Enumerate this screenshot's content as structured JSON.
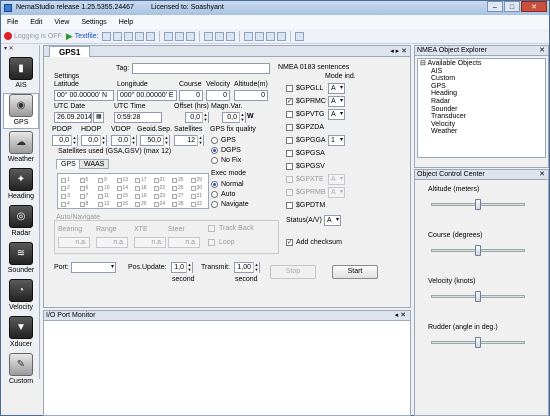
{
  "app": {
    "title": "NemaStudio release 1.25.5355.24467",
    "license": "Licensed to: Soashyant",
    "win_min": "–",
    "win_max": "□",
    "win_close": "✕"
  },
  "menu": [
    "File",
    "Edit",
    "View",
    "Settings",
    "Help"
  ],
  "toolbar": {
    "logging": "Logging is OFF",
    "textfile": "Textfile:"
  },
  "sidebar": {
    "pin": "▾ ✕",
    "items": [
      {
        "label": "AIS",
        "icon": "ais-icon",
        "glyph": "▮"
      },
      {
        "label": "GPS",
        "icon": "gps-icon",
        "glyph": "◉"
      },
      {
        "label": "Weather",
        "icon": "weather-icon",
        "glyph": "☁"
      },
      {
        "label": "Heading",
        "icon": "compass-icon",
        "glyph": "✦"
      },
      {
        "label": "Radar",
        "icon": "radar-icon",
        "glyph": "◎"
      },
      {
        "label": "Sounder",
        "icon": "sounder-icon",
        "glyph": "≋"
      },
      {
        "label": "Velocity",
        "icon": "speedometer-icon",
        "glyph": "◔"
      },
      {
        "label": "Xducer",
        "icon": "transducer-icon",
        "glyph": "▼"
      },
      {
        "label": "Custom",
        "icon": "custom-tool-icon",
        "glyph": "✎"
      }
    ]
  },
  "gps": {
    "tab": "GPS1",
    "tab_controls": "◂ ▸ ✕",
    "tag_label": "Tag:",
    "tag_value": "",
    "settings_title": "Settings",
    "labels": {
      "latitude": "Latitude",
      "longitude": "Longitude",
      "course": "Course",
      "velocity": "Velocity",
      "altitude": "Altitude(m)",
      "utc_date": "UTC Date",
      "utc_time": "UTC Time",
      "offset": "Offset (hrs)",
      "magn_var": "Magn.Var.",
      "pdop": "PDOP",
      "hdop": "HDOP",
      "vdop": "VDOP",
      "geoid_sep": "Geoid.Sep.",
      "satellites": "Satellites",
      "sat_used": "Satellites used (GSA,GSV) (max 12)",
      "fix_quality": "GPS fix quality",
      "exec_mode": "Exec mode",
      "autonav": "Auto/Navigate",
      "bearing": "Bearing",
      "range": "Range",
      "xte": "XTE",
      "steer": "Steer",
      "track_back": "Track Back",
      "loop": "Loop",
      "port": "Port:",
      "pos_update": "Pos.Update:",
      "transmit": "Transmit:",
      "second": "second"
    },
    "values": {
      "latitude": "00° 00.00000' N",
      "longitude": "000° 00.00000' E",
      "course": "0",
      "velocity": "0",
      "altitude": "0",
      "utc_date": "26.09.2014",
      "utc_time": "0:59:28",
      "offset": "0,0",
      "magn_var": "0,0",
      "magn_var_dir": "W",
      "pdop": "0,0",
      "hdop": "0,0",
      "vdop": "0,0",
      "geoid_sep": "50,0",
      "satellites": "12",
      "bearing": "n.a.",
      "range": "n.a.",
      "xte": "n.a.",
      "steer": "n.a.",
      "port": "",
      "pos_update": "1,0",
      "transmit": "1,00"
    },
    "sat_tabs": [
      "GPS",
      "WAAS"
    ],
    "sat_columns": [
      [
        "1",
        "2",
        "3",
        "4"
      ],
      [
        "5",
        "6",
        "7",
        "8"
      ],
      [
        "9",
        "10",
        "11",
        "12"
      ],
      [
        "13",
        "14",
        "15",
        "16"
      ],
      [
        "17",
        "18",
        "19",
        "20"
      ],
      [
        "21",
        "22",
        "23",
        "24"
      ],
      [
        "25",
        "26",
        "27",
        "28"
      ],
      [
        "29",
        "30",
        "31",
        "32"
      ]
    ],
    "fix_options": [
      "GPS",
      "DGPS",
      "No Fix"
    ],
    "fix_selected": "DGPS",
    "exec_options": [
      "Normal",
      "Auto",
      "Navigate"
    ],
    "exec_selected": "Normal",
    "buttons": {
      "stop": "Stop",
      "start": "Start"
    }
  },
  "nmea": {
    "title": "NMEA 0183 sentences",
    "mode_header": "Mode ind.",
    "sentences": [
      {
        "name": "$GPGLL",
        "checked": false,
        "mode": "A",
        "enabled": true
      },
      {
        "name": "$GPRMC",
        "checked": true,
        "mode": "A",
        "enabled": true
      },
      {
        "name": "$GPVTG",
        "checked": false,
        "mode": "A",
        "enabled": true
      },
      {
        "name": "$GPZDA",
        "checked": false,
        "mode": "",
        "enabled": true
      },
      {
        "name": "$GPGGA",
        "checked": false,
        "mode": "1",
        "enabled": true
      },
      {
        "name": "$GPGSA",
        "checked": false,
        "mode": "",
        "enabled": true
      },
      {
        "name": "$GPGSV",
        "checked": false,
        "mode": "",
        "enabled": true
      },
      {
        "name": "$GPXTE",
        "checked": false,
        "mode": "A",
        "enabled": false
      },
      {
        "name": "$GPRMB",
        "checked": false,
        "mode": "A",
        "enabled": false
      },
      {
        "name": "$GPDTM",
        "checked": false,
        "mode": "",
        "enabled": true
      }
    ],
    "status_label": "Status(A/V)",
    "status_value": "A",
    "add_checksum": "Add checksum"
  },
  "io": {
    "title": "I/O Port Monitor",
    "controls": "◂ ✕"
  },
  "explorer": {
    "title": "NMEA Object Explorer",
    "root": "Available Objects",
    "items": [
      "AIS",
      "Custom",
      "GPS",
      "Heading",
      "Radar",
      "Sounder",
      "Transducer",
      "Velocity",
      "Weather"
    ]
  },
  "occ": {
    "title": "Object Control Center",
    "sliders": [
      {
        "label": "Altitude (meters)",
        "position": 0.5
      },
      {
        "label": "Course (degrees)",
        "position": 0.5
      },
      {
        "label": "Velocity (knots)",
        "position": 0.5
      },
      {
        "label": "Rudder (angle in deg.)",
        "position": 0.5
      }
    ]
  }
}
